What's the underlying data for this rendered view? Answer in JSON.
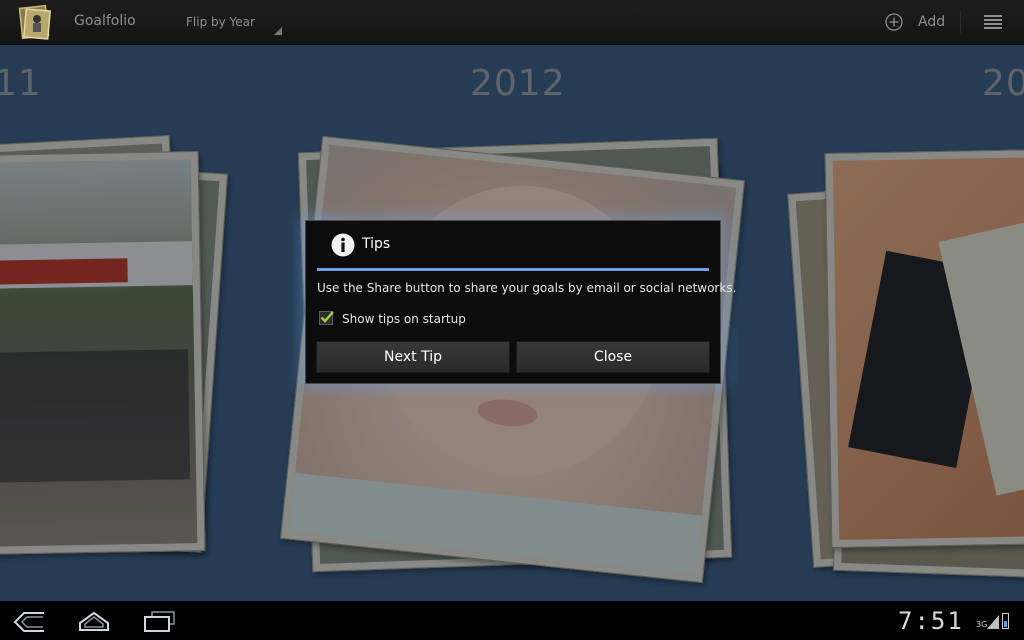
{
  "action_bar": {
    "app_title": "Goalfolio",
    "view_spinner": "Flip by Year",
    "add_label": "Add"
  },
  "gallery": {
    "years": [
      "11",
      "2012",
      "20"
    ]
  },
  "dialog": {
    "title": "Tips",
    "message": "Use the Share button to share your goals by email or social networks.",
    "checkbox_label": "Show tips on startup",
    "checkbox_checked": true,
    "next_button": "Next Tip",
    "close_button": "Close"
  },
  "system_bar": {
    "clock": "7:51",
    "signal": "3G"
  },
  "colors": {
    "accent": "#6f9fe6",
    "background": "#3b5d82"
  }
}
